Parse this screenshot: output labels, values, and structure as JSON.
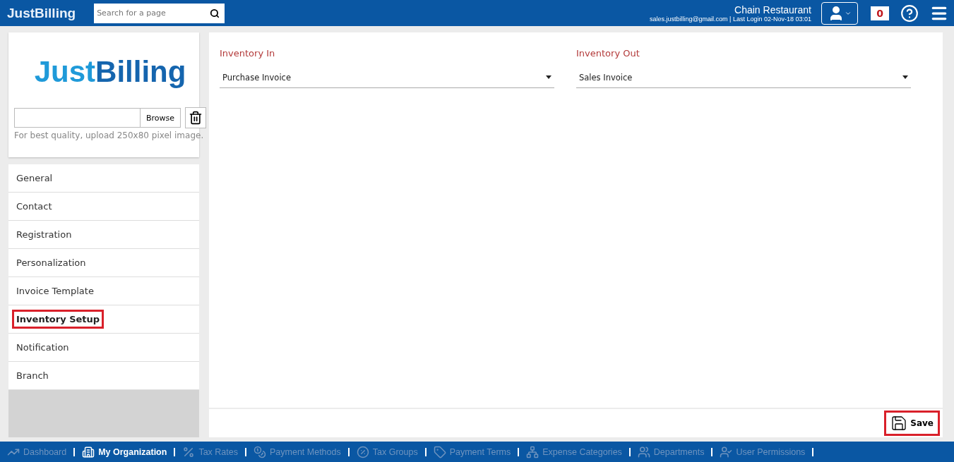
{
  "header": {
    "logo": [
      "Just",
      "Billing"
    ],
    "search": {
      "placeholder": "Search for a page"
    },
    "org_name": "Chain Restaurant",
    "login_info": "sales.justbilling@gmail.com | Last Login 02-Nov-18 03:01",
    "notifications": "0"
  },
  "logo_card": {
    "logo": [
      "Just",
      "Billing"
    ],
    "browse": "Browse",
    "hint": "For best quality, upload 250x80 pixel image."
  },
  "menu": [
    {
      "label": "General",
      "selected": false,
      "highlighted": false
    },
    {
      "label": "Contact",
      "selected": false,
      "highlighted": false
    },
    {
      "label": "Registration",
      "selected": false,
      "highlighted": false
    },
    {
      "label": "Personalization",
      "selected": false,
      "highlighted": false
    },
    {
      "label": "Invoice Template",
      "selected": false,
      "highlighted": false
    },
    {
      "label": "Inventory Setup",
      "selected": true,
      "highlighted": true
    },
    {
      "label": "Notification",
      "selected": false,
      "highlighted": false
    },
    {
      "label": "Branch",
      "selected": false,
      "highlighted": false
    }
  ],
  "fields": [
    {
      "label": "Inventory In",
      "value": "Purchase Invoice"
    },
    {
      "label": "Inventory Out",
      "value": "Sales Invoice"
    }
  ],
  "save": {
    "label": "Save",
    "highlighted": true
  },
  "bottom_nav": [
    {
      "label": "Dashboard",
      "selected": false
    },
    {
      "label": "My Organization",
      "selected": true
    },
    {
      "label": "Tax Rates",
      "selected": false
    },
    {
      "label": "Payment Methods",
      "selected": false
    },
    {
      "label": "Tax Groups",
      "selected": false
    },
    {
      "label": "Payment Terms",
      "selected": false
    },
    {
      "label": "Expense Categories",
      "selected": false
    },
    {
      "label": "Departments",
      "selected": false
    },
    {
      "label": "User Permissions",
      "selected": false
    }
  ]
}
